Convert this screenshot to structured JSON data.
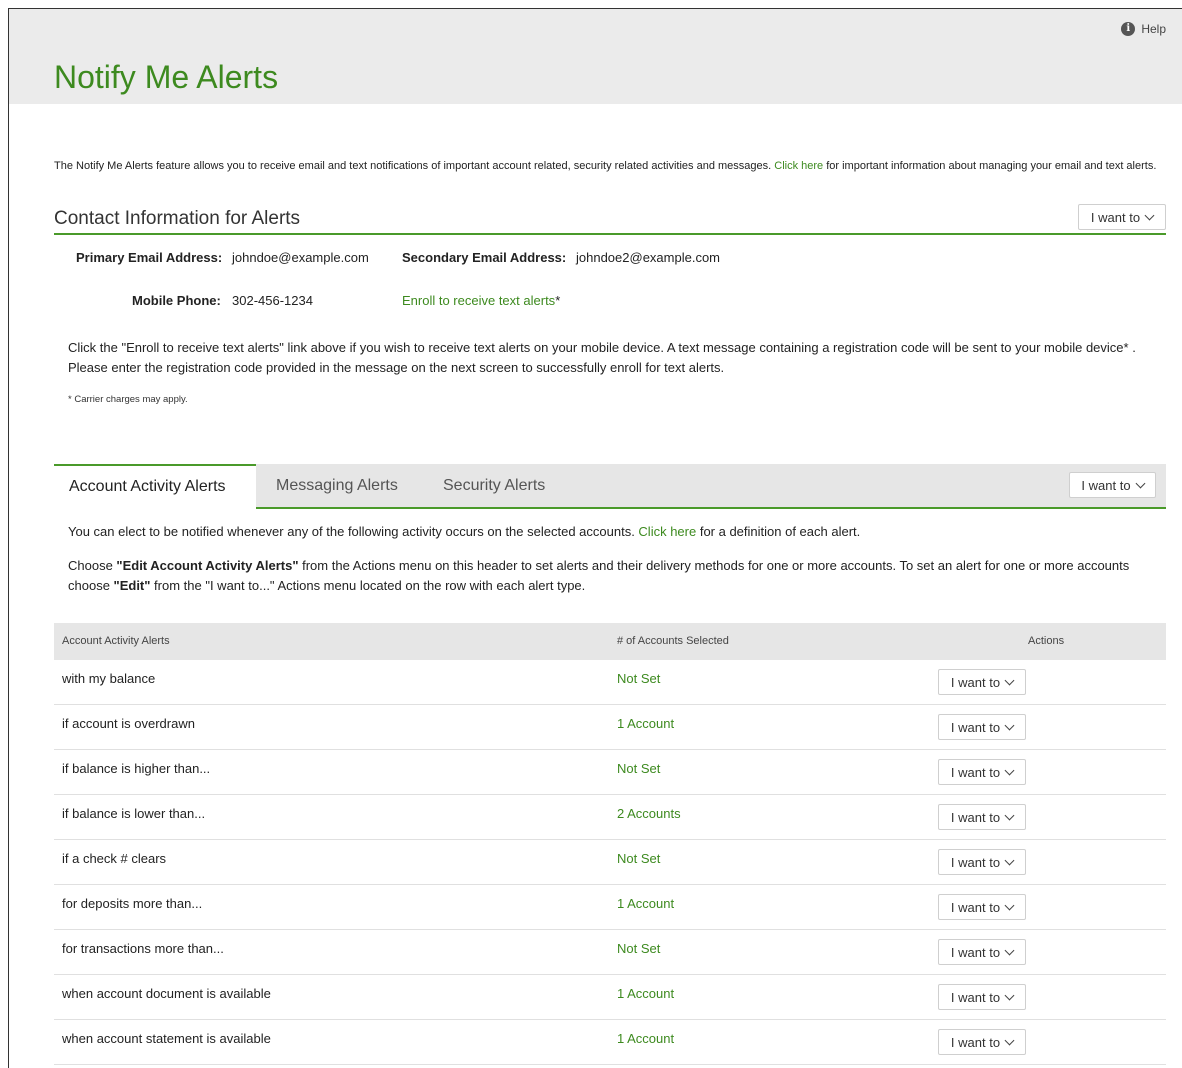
{
  "header": {
    "help_label": "Help",
    "help_icon": "info-icon",
    "title": "Notify Me Alerts"
  },
  "intro": {
    "text_before": "The Notify Me Alerts feature allows you to receive email and text notifications of important account related, security related activities and messages. ",
    "link": "Click here",
    "text_after": " for important information about managing your email and text alerts."
  },
  "contact": {
    "title": "Contact Information for Alerts",
    "menu_label": "I want to",
    "primary_email_label": "Primary Email Address:",
    "primary_email_value": "johndoe@example.com",
    "secondary_email_label": "Secondary Email Address:",
    "secondary_email_value": "johndoe2@example.com",
    "mobile_label": "Mobile Phone:",
    "mobile_value": "302-456-1234",
    "enroll_link": "Enroll to receive text alerts",
    "enroll_asterisk": "*",
    "instructions": "Click the \"Enroll to receive text alerts\" link above if you wish to receive text alerts on your mobile device. A text message containing a registration code will be sent to your mobile device* . Please enter the registration code provided in the message on the next screen to successfully enroll for text alerts.",
    "carrier_note": "* Carrier charges may apply."
  },
  "tabs": {
    "items": [
      "Account Activity Alerts",
      "Messaging Alerts",
      "Security Alerts"
    ],
    "active": "Account Activity Alerts",
    "menu_label": "I want to"
  },
  "activity": {
    "line1_before": "You can elect to be notified whenever any of the following activity occurs on the selected accounts. ",
    "line1_link": "Click here",
    "line1_after": " for a definition of each alert.",
    "line2_a": "Choose ",
    "line2_b": "\"Edit Account Activity Alerts\"",
    "line2_c": " from the Actions menu on this header to set alerts and their delivery methods for one or more accounts. To set an alert for one or more accounts choose ",
    "line2_d": "\"Edit\"",
    "line2_e": " from the \"I want to...\" Actions menu located on the row with each alert type."
  },
  "table": {
    "columns": [
      "Account Activity Alerts",
      "# of Accounts Selected",
      "Actions"
    ],
    "action_label": "I want to",
    "rows": [
      {
        "name": "with my balance",
        "count": "Not Set"
      },
      {
        "name": "if account is overdrawn",
        "count": "1 Account"
      },
      {
        "name": "if balance is higher than...",
        "count": "Not Set"
      },
      {
        "name": "if balance is lower than...",
        "count": "2 Accounts"
      },
      {
        "name": "if a check # clears",
        "count": "Not Set"
      },
      {
        "name": "for deposits more than...",
        "count": "1 Account"
      },
      {
        "name": "for transactions more than...",
        "count": "Not Set"
      },
      {
        "name": "when account document is available",
        "count": "1 Account"
      },
      {
        "name": "when account statement is available",
        "count": "1 Account"
      }
    ]
  },
  "colors": {
    "accent_green": "#3d8a1f",
    "rule_green": "#4a9a2a",
    "header_bg": "#ebebeb"
  }
}
